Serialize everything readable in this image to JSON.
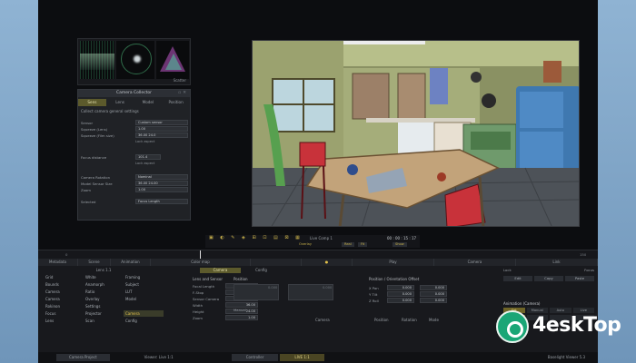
{
  "scopes": {
    "label": "Scatter"
  },
  "camera_panel": {
    "title": "Camera Collector",
    "tabs": [
      "Sens",
      "Lens",
      "Model",
      "Position"
    ],
    "subtitle": "Collect camera general settings",
    "rows": [
      {
        "label": "Sensor",
        "value": "Custom sensor"
      },
      {
        "label": "Squeeze (Lens)",
        "value": "1.00"
      },
      {
        "label": "Squeeze (Film size)",
        "value": "36.00   24.0"
      },
      {
        "label": "",
        "value": "Lock aspect"
      },
      {
        "label": "Focus distance",
        "value": "101.4"
      },
      {
        "label": "",
        "value": "Lock aspect"
      },
      {
        "label": "Camera Rotation",
        "value": "Nominal"
      },
      {
        "label": "Model Sensor Size",
        "value": "36.00   24.00"
      },
      {
        "label": "Zoom",
        "value": "1.00"
      },
      {
        "label": "Selected",
        "value": "Focus Length"
      }
    ]
  },
  "playbar": {
    "clip_name": "Live Comp 1",
    "timecode": "00 : 00 : 15 : 17",
    "sub_label": "Overlay",
    "buttons": [
      "Real",
      "Fit",
      "Show"
    ]
  },
  "timeline": {
    "ticks": [
      "0",
      "50",
      "100",
      "150"
    ]
  },
  "toolbar": {
    "items": [
      "Metadata",
      "Scene",
      "Animation",
      "Color map",
      "",
      "",
      "Play",
      "Camera",
      "Link"
    ]
  },
  "library": {
    "title": "Lens 1.1",
    "cells": [
      [
        "Grid",
        "White",
        "Framing"
      ],
      [
        "Bounds",
        "Anamorph",
        "Subject"
      ],
      [
        "Camera",
        "Ratio",
        "LUT"
      ],
      [
        "Camera",
        "Overlay",
        "Model"
      ],
      [
        "Rokinon",
        "Settings",
        ""
      ],
      [
        "Focus",
        "Projector",
        "Camera"
      ],
      [
        "Lens",
        "Scan",
        "Config"
      ]
    ]
  },
  "params": {
    "tabs": [
      "Camera",
      "Config"
    ],
    "lens_title": "Lens and Sensor",
    "lens_rows": [
      {
        "label": "Focal Length",
        "value": "36.00"
      },
      {
        "label": "F-Stop",
        "value": "3000.00"
      },
      {
        "label": "Sensor Camera",
        "value": ""
      },
      {
        "label": "Width",
        "value": "36.00"
      },
      {
        "label": "Height",
        "value": "24.00"
      },
      {
        "label": "Zoom",
        "value": "1.00"
      }
    ],
    "position_title": "Position",
    "position_values": [
      "0.000",
      "0.000",
      "0.000"
    ],
    "position_sub": "Manual",
    "rotation_title": "Position / Orientation Offset",
    "rotation_rows": [
      {
        "label": "X Pan",
        "a": "0.000",
        "b": "0.000"
      },
      {
        "label": "Y Tilt",
        "a": "0.000",
        "b": "0.000"
      },
      {
        "label": "Z Roll",
        "a": "0.000",
        "b": "0.000"
      }
    ]
  },
  "right_panel": {
    "header_labels": [
      "Lock",
      "Focus"
    ],
    "buttons": [
      "Edit",
      "Copy",
      "Paste"
    ],
    "anim_title": "Animation (Camera)",
    "anim_headers": [
      "Set",
      "Manual",
      "Auto",
      "Live"
    ],
    "anim_rows": [
      [
        "On",
        "",
        "",
        ""
      ],
      [
        "",
        "",
        "",
        ""
      ]
    ]
  },
  "mid_tabs": [
    "Camera",
    "Position",
    "Rotation",
    "Mode"
  ],
  "status": {
    "left": "Camera Project",
    "viewer_label": "Viewer: Live 1:1",
    "mode_a": "Controller",
    "mode_b": "LIVE 1:1",
    "right": "Baselight Viewer 5.3"
  },
  "watermark": {
    "text": "4eskTop"
  },
  "colors": {
    "accent": "#e2c14b",
    "panel": "#202226",
    "bg": "#0c0d10",
    "watermark_green": "#1aa676"
  }
}
